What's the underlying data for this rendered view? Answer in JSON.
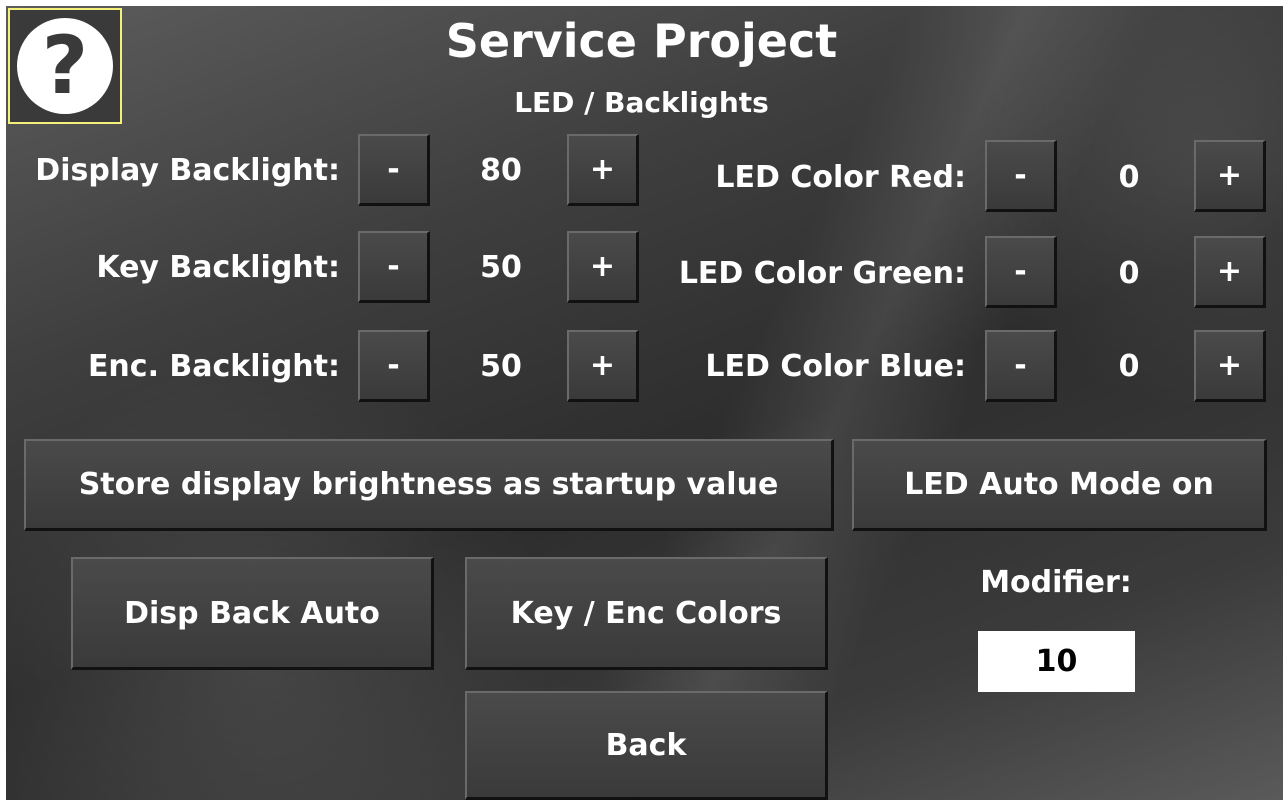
{
  "header": {
    "title": "Service Project",
    "subtitle": "LED / Backlights"
  },
  "help": {
    "glyph": "?"
  },
  "backlights": [
    {
      "label": "Display Backlight:",
      "value": "80",
      "minus": "-",
      "plus": "+"
    },
    {
      "label": "Key Backlight:",
      "value": "50",
      "minus": "-",
      "plus": "+"
    },
    {
      "label": "Enc. Backlight:",
      "value": "50",
      "minus": "-",
      "plus": "+"
    }
  ],
  "led_colors": [
    {
      "label": "LED Color Red:",
      "value": "0",
      "minus": "-",
      "plus": "+"
    },
    {
      "label": "LED Color Green:",
      "value": "0",
      "minus": "-",
      "plus": "+"
    },
    {
      "label": "LED Color Blue:",
      "value": "0",
      "minus": "-",
      "plus": "+"
    }
  ],
  "buttons": {
    "store": "Store display brightness as startup value",
    "led_auto": "LED Auto Mode on",
    "disp_back_auto": "Disp Back Auto",
    "key_enc_colors": "Key / Enc Colors",
    "back": "Back"
  },
  "modifier": {
    "label": "Modifier:",
    "value": "10"
  }
}
